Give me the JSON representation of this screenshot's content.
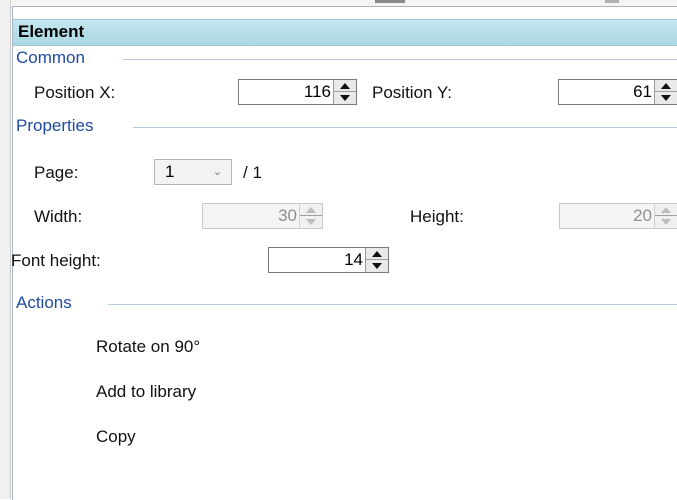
{
  "header": {
    "title": "Element"
  },
  "sections": {
    "common": "Common",
    "properties": "Properties",
    "actions": "Actions"
  },
  "common": {
    "position_x_label": "Position X:",
    "position_x_value": "116",
    "position_y_label": "Position Y:",
    "position_y_value": "61"
  },
  "properties": {
    "page_label": "Page:",
    "page_value": "1",
    "page_total": "/ 1",
    "width_label": "Width:",
    "width_value": "30",
    "height_label": "Height:",
    "height_value": "20",
    "font_height_label": "Font height:",
    "font_height_value": "14"
  },
  "actions": {
    "rotate": "Rotate on 90°",
    "add_to_library": "Add to library",
    "copy": "Copy"
  }
}
